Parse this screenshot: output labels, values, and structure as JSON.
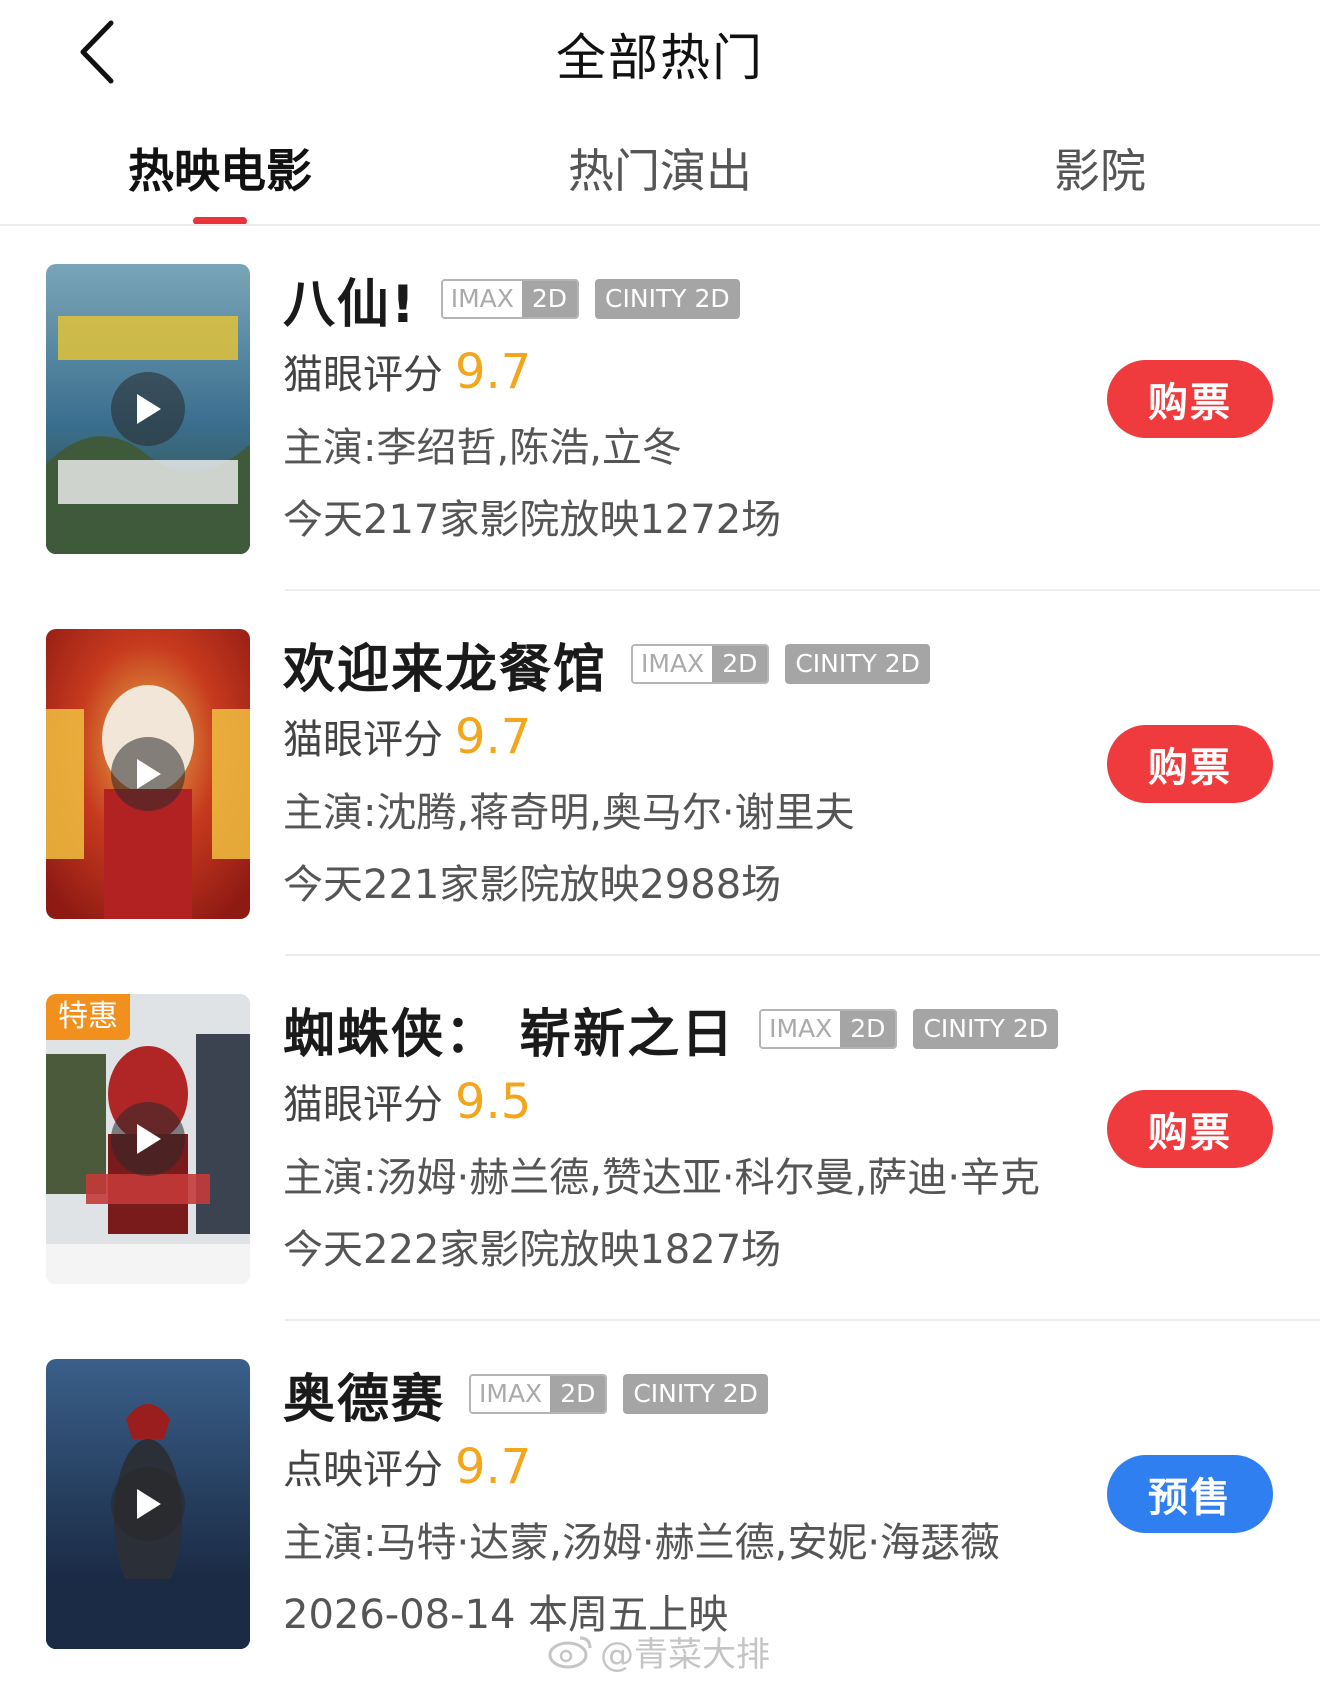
{
  "header": {
    "title": "全部热门"
  },
  "tabs": [
    {
      "label": "热映电影",
      "active": true
    },
    {
      "label": "热门演出",
      "active": false
    },
    {
      "label": "影院",
      "active": false
    }
  ],
  "accent_color": "#e8343a",
  "score_color": "#f3a51c",
  "movies": [
    {
      "name": "八仙!",
      "badges": {
        "imax_a": "IMAX",
        "imax_b": "2D",
        "cinity": "CINITY 2D"
      },
      "score_label": "猫眼评分",
      "score": "9.7",
      "cast": "主演:李绍哲,陈浩,立冬",
      "shows": "今天217家影院放映1272场",
      "button": "购票",
      "button_color": "#ef3a3e",
      "poster_colors": [
        "#3b6f8f",
        "#7aa5b8",
        "#3e5a3a"
      ]
    },
    {
      "name": "欢迎来龙餐馆",
      "badges": {
        "imax_a": "IMAX",
        "imax_b": "2D",
        "cinity": "CINITY 2D"
      },
      "score_label": "猫眼评分",
      "score": "9.7",
      "cast": "主演:沈腾,蒋奇明,奥马尔·谢里夫",
      "shows": "今天221家影院放映2988场",
      "button": "购票",
      "button_color": "#ef3a3e",
      "poster_colors": [
        "#8e1a14",
        "#c73a1e",
        "#e6b64a"
      ]
    },
    {
      "name": "蜘蛛侠： 崭新之日",
      "badges": {
        "imax_a": "IMAX",
        "imax_b": "2D",
        "cinity": "CINITY 2D"
      },
      "score_label": "猫眼评分",
      "score": "9.5",
      "cast": "主演:汤姆·赫兰德,赞达亚·科尔曼,萨迪·辛克",
      "shows": "今天222家影院放映1827场",
      "button": "购票",
      "button_color": "#ef3a3e",
      "discount": "特惠",
      "poster_colors": [
        "#dfe3e6",
        "#b02626",
        "#4a5a3a"
      ]
    },
    {
      "name": "奥德赛",
      "badges": {
        "imax_a": "IMAX",
        "imax_b": "2D",
        "cinity": "CINITY 2D"
      },
      "score_label": "点映评分",
      "score": "9.7",
      "cast": "主演:马特·达蒙,汤姆·赫兰德,安妮·海瑟薇",
      "shows": "2026-08-14 本周五上映",
      "button": "预售",
      "button_color": "#2f7ff0",
      "poster_colors": [
        "#1b2a45",
        "#3a5f8a",
        "#9a1e1e"
      ]
    }
  ],
  "watermark": {
    "text": "@青菜大排"
  }
}
